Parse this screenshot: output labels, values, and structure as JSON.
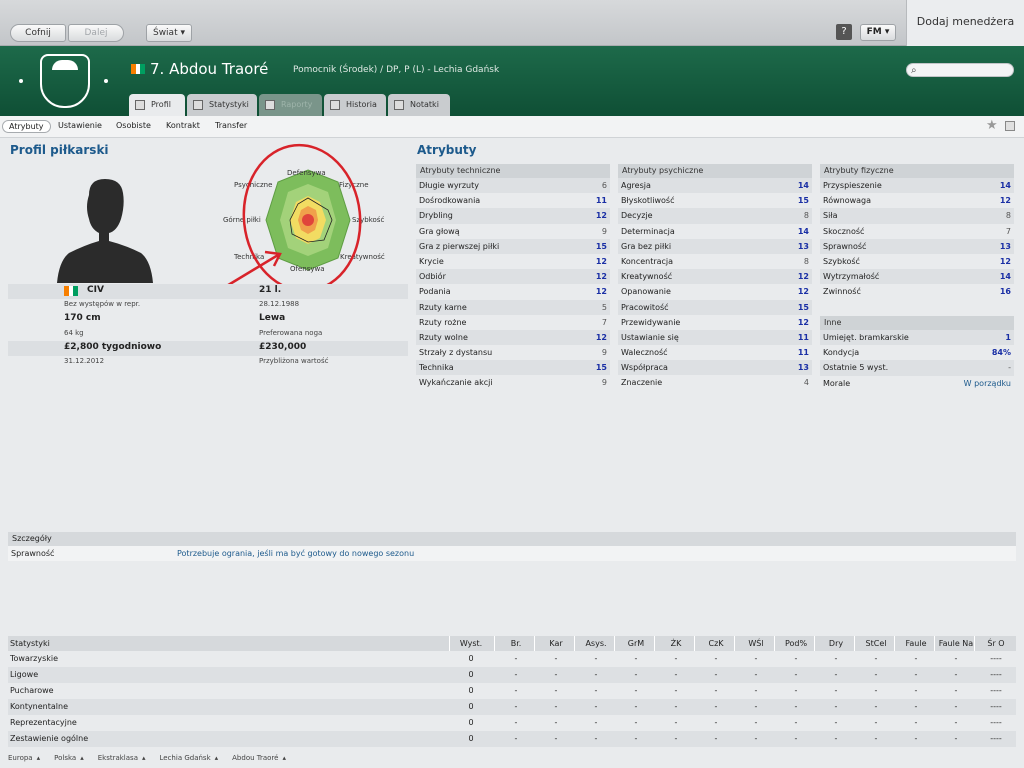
{
  "topbar": {
    "back": "Cofnij",
    "forward": "Dalej",
    "world": "Świat",
    "help": "?",
    "fm": "FM",
    "add_manager": "Dodaj menedżera"
  },
  "header": {
    "player_title": "7. Abdou Traoré",
    "player_subtitle": "Pomocnik (Środek) / DP, P (L) - Lechia Gdańsk",
    "flag_colors": [
      "#f77f00",
      "#ffffff",
      "#009e60"
    ]
  },
  "tabs": [
    {
      "label": "Profil",
      "state": "active"
    },
    {
      "label": "Statystyki",
      "state": "inactive"
    },
    {
      "label": "Raporty",
      "state": "disabled"
    },
    {
      "label": "Historia",
      "state": "inactive"
    },
    {
      "label": "Notatki",
      "state": "inactive"
    }
  ],
  "subnav": [
    "Atrybuty",
    "Ustawienie",
    "Osobiste",
    "Kontrakt",
    "Transfer"
  ],
  "profile": {
    "title": "Profil piłkarski",
    "radar_labels": {
      "top": "Defensywa",
      "top_right": "Fizyczne",
      "right": "Szybkość",
      "bottom_right": "Kreatywność",
      "bottom": "Ofensywa",
      "bottom_left": "Technika",
      "left": "Górne piłki",
      "top_left": "Psychiczne"
    },
    "nationality": "CIV",
    "caps": "Bez występów w repr.",
    "age": "21 l.",
    "dob": "28.12.1988",
    "height": "170 cm",
    "weight": "64 kg",
    "foot": "Lewa",
    "foot_label": "Preferowana noga",
    "wage": "£2,800 tygodniowo",
    "contract": "31.12.2012",
    "value": "£230,000",
    "value_label": "Przybliżona wartość"
  },
  "attributes": {
    "title": "Atrybuty",
    "technical": {
      "header": "Atrybuty techniczne",
      "rows": [
        {
          "name": "Długie wyrzuty",
          "value": "6"
        },
        {
          "name": "Dośrodkowania",
          "value": "11"
        },
        {
          "name": "Drybling",
          "value": "12"
        },
        {
          "name": "Gra głową",
          "value": "9"
        },
        {
          "name": "Gra z pierwszej piłki",
          "value": "15"
        },
        {
          "name": "Krycie",
          "value": "12"
        },
        {
          "name": "Odbiór",
          "value": "12"
        },
        {
          "name": "Podania",
          "value": "12"
        },
        {
          "name": "Rzuty karne",
          "value": "5"
        },
        {
          "name": "Rzuty rożne",
          "value": "7"
        },
        {
          "name": "Rzuty wolne",
          "value": "12"
        },
        {
          "name": "Strzały z dystansu",
          "value": "9"
        },
        {
          "name": "Technika",
          "value": "15"
        },
        {
          "name": "Wykańczanie akcji",
          "value": "9"
        }
      ]
    },
    "mental": {
      "header": "Atrybuty psychiczne",
      "rows": [
        {
          "name": "Agresja",
          "value": "14"
        },
        {
          "name": "Błyskotliwość",
          "value": "15"
        },
        {
          "name": "Decyzje",
          "value": "8"
        },
        {
          "name": "Determinacja",
          "value": "14"
        },
        {
          "name": "Gra bez piłki",
          "value": "13"
        },
        {
          "name": "Koncentracja",
          "value": "8"
        },
        {
          "name": "Kreatywność",
          "value": "12"
        },
        {
          "name": "Opanowanie",
          "value": "12"
        },
        {
          "name": "Pracowitość",
          "value": "15"
        },
        {
          "name": "Przewidywanie",
          "value": "12"
        },
        {
          "name": "Ustawianie się",
          "value": "11"
        },
        {
          "name": "Waleczność",
          "value": "11"
        },
        {
          "name": "Współpraca",
          "value": "13"
        },
        {
          "name": "Znaczenie",
          "value": "4"
        }
      ]
    },
    "physical": {
      "header": "Atrybuty fizyczne",
      "rows": [
        {
          "name": "Przyspieszenie",
          "value": "14"
        },
        {
          "name": "Równowaga",
          "value": "12"
        },
        {
          "name": "Siła",
          "value": "8"
        },
        {
          "name": "Skoczność",
          "value": "7"
        },
        {
          "name": "Sprawność",
          "value": "13"
        },
        {
          "name": "Szybkość",
          "value": "12"
        },
        {
          "name": "Wytrzymałość",
          "value": "14"
        },
        {
          "name": "Zwinność",
          "value": "16"
        }
      ]
    },
    "other": {
      "header": "Inne",
      "rows": [
        {
          "name": "Umiejęt. bramkarskie",
          "value": "1"
        },
        {
          "name": "Kondycja",
          "value": "84%"
        },
        {
          "name": "Ostatnie 5 wyst.",
          "value": "-"
        },
        {
          "name": "Morale",
          "value": "W porządku"
        }
      ]
    }
  },
  "details": {
    "header": "Szczegóły",
    "label": "Sprawność",
    "text": "Potrzebuje ograniа, jeśli ma być gotowy do nowego sezonu"
  },
  "stats": {
    "header": "Statystyki",
    "columns": [
      "Wyst.",
      "Br.",
      "Kar",
      "Asys.",
      "GrM",
      "ŻK",
      "CzK",
      "WŚl",
      "Pod%",
      "Dry",
      "StCel",
      "Faule",
      "Faule Na",
      "Śr O"
    ],
    "rows": [
      {
        "label": "Towarzyskie",
        "values": [
          "0",
          "-",
          "-",
          "-",
          "-",
          "-",
          "-",
          "-",
          "-",
          "-",
          "-",
          "-",
          "-",
          "----"
        ]
      },
      {
        "label": "Ligowe",
        "values": [
          "0",
          "-",
          "-",
          "-",
          "-",
          "-",
          "-",
          "-",
          "-",
          "-",
          "-",
          "-",
          "-",
          "----"
        ]
      },
      {
        "label": "Pucharowe",
        "values": [
          "0",
          "-",
          "-",
          "-",
          "-",
          "-",
          "-",
          "-",
          "-",
          "-",
          "-",
          "-",
          "-",
          "----"
        ]
      },
      {
        "label": "Kontynentalne",
        "values": [
          "0",
          "-",
          "-",
          "-",
          "-",
          "-",
          "-",
          "-",
          "-",
          "-",
          "-",
          "-",
          "-",
          "----"
        ]
      },
      {
        "label": "Reprezentacyjne",
        "values": [
          "0",
          "-",
          "-",
          "-",
          "-",
          "-",
          "-",
          "-",
          "-",
          "-",
          "-",
          "-",
          "-",
          "----"
        ]
      },
      {
        "label": "Zestawienie ogólne",
        "values": [
          "0",
          "-",
          "-",
          "-",
          "-",
          "-",
          "-",
          "-",
          "-",
          "-",
          "-",
          "-",
          "-",
          "----"
        ]
      }
    ]
  },
  "breadcrumbs": [
    "Europa",
    "Polska",
    "Ekstraklasa",
    "Lechia Gdańsk",
    "Abdou Traoré"
  ]
}
